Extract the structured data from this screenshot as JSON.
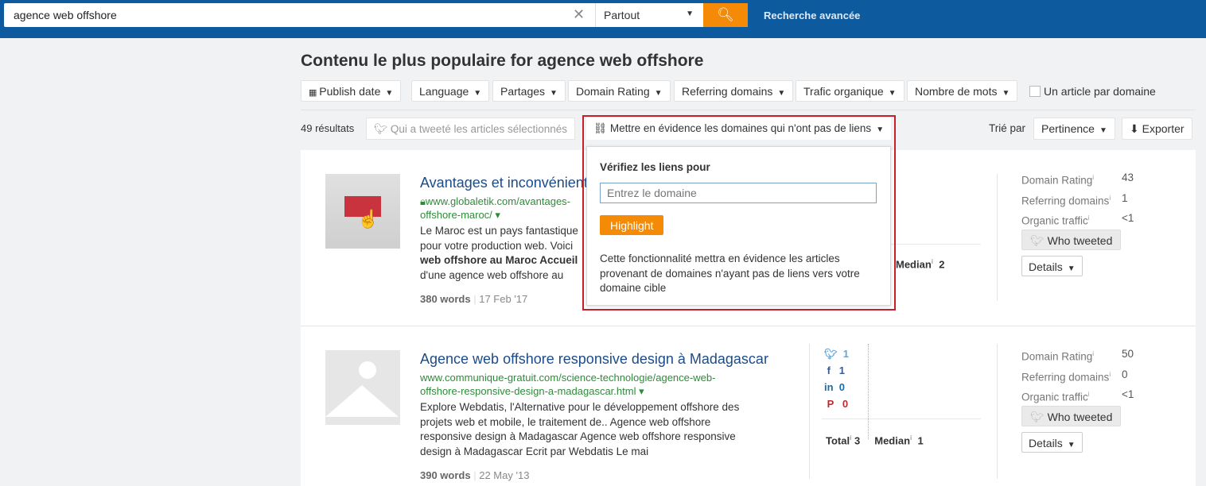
{
  "topbar": {
    "query": "agence web offshore",
    "scope": "Partout",
    "advanced": "Recherche avancée"
  },
  "page_title": "Contenu le plus populaire for agence web offshore",
  "filters": [
    "Publish date",
    "Language",
    "Partages",
    "Domain Rating",
    "Referring domains",
    "Trafic organique",
    "Nombre de mots"
  ],
  "one_per_domain": "Un article par domaine",
  "toolbar": {
    "results": "49 résultats",
    "who_tweeted": "Qui a tweeté les articles sélectionnés",
    "highlight": "Mettre en évidence les domaines qui n'ont pas de liens",
    "sort_label": "Trié par",
    "sort_value": "Pertinence",
    "export": "Exporter"
  },
  "popup": {
    "heading": "Vérifiez les liens pour",
    "placeholder": "Entrez le domaine",
    "button": "Highlight",
    "note": "Cette fonctionnalité mettra en évidence les articles provenant de domaines n'ayant pas de liens vers votre domaine cible"
  },
  "labels": {
    "dr": "Domain Rating",
    "rd": "Referring domains",
    "ot": "Organic traffic",
    "who": "Who tweeted",
    "details": "Details",
    "total": "Total",
    "median": "Median",
    "info": "i"
  },
  "articles": [
    {
      "title": "Avantages et inconvénients",
      "url1": "www.globaletik.com/avantages-",
      "url2": "offshore-maroc/",
      "desc": [
        "Le Maroc est un pays fantastique",
        "pour votre production web. Voici",
        "web offshore au Maroc Accueil",
        "d'une agence web offshore au"
      ],
      "words": "380 words",
      "date": "17 Feb '17",
      "median": "2",
      "dr": "43",
      "rd": "1",
      "ot": "<1"
    },
    {
      "title": "Agence web offshore responsive design à Madagascar",
      "url1": "www.communique-gratuit.com/science-technologie/agence-web-",
      "url2": "offshore-responsive-design-a-madagascar.html",
      "desc": [
        "Explore Webdatis, l'Alternative pour le développement offshore des",
        "projets web et mobile, le traitement de.. Agence web offshore",
        "responsive design à Madagascar Agence web offshore responsive",
        "design à Madagascar Ecrit par Webdatis Le mai"
      ],
      "words": "390 words",
      "date": "22 May '13",
      "twitter": "1",
      "facebook": "1",
      "linkedin": "0",
      "pinterest": "0",
      "total": "3",
      "median": "1",
      "dr": "50",
      "rd": "0",
      "ot": "<1"
    }
  ],
  "colors": {
    "topbar": "#0d5a9e",
    "accent": "#f58a07",
    "highlight_border": "#c8202b",
    "link": "#1a4c8a",
    "url": "#2e8b3a"
  }
}
